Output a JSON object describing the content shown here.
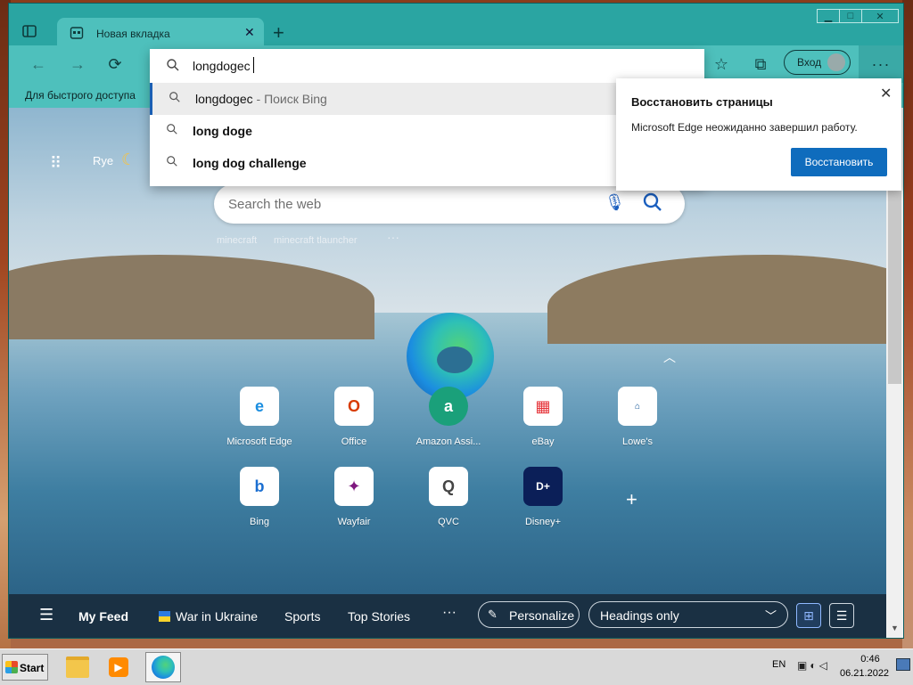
{
  "window": {
    "tab_title": "Новая вкладка",
    "controls": {
      "minimize": "▁",
      "maximize": "□",
      "close": "✕"
    }
  },
  "toolbar": {
    "signin_label": "Вход",
    "menu_label": "···"
  },
  "favorites_bar": {
    "label": "Для быстрого доступа"
  },
  "address_bar": {
    "value": "longdogec",
    "suggestions": [
      {
        "text": "longdogec",
        "suffix": " - Поиск Bing"
      },
      {
        "text": "long doge",
        "suffix": ""
      },
      {
        "text": "long dog challenge",
        "suffix": ""
      }
    ]
  },
  "restore_popup": {
    "title": "Восстановить страницы",
    "message": "Microsoft Edge неожиданно завершил работу.",
    "button": "Восстановить"
  },
  "newtab": {
    "weather_location": "Rye",
    "search_placeholder": "Search the web",
    "recent_searches": [
      "minecraft",
      "minecraft tlauncher"
    ],
    "more": "···",
    "tiles": [
      {
        "label": "Microsoft Edge",
        "icon": "edge-icon",
        "glyph": "e",
        "color": "#1b8ee0"
      },
      {
        "label": "Office",
        "icon": "office-icon",
        "glyph": "O",
        "color": "#d83b01"
      },
      {
        "label": "Amazon Assi...",
        "icon": "amazon-icon",
        "glyph": "a",
        "color": "#1aa07a"
      },
      {
        "label": "eBay",
        "icon": "ebay-icon",
        "glyph": "🛍",
        "color": "#e53238"
      },
      {
        "label": "Lowe's",
        "icon": "lowes-icon",
        "glyph": "L",
        "color": "#004990"
      },
      {
        "label": "Bing",
        "icon": "bing-icon",
        "glyph": "b",
        "color": "#1b6fd1"
      },
      {
        "label": "Wayfair",
        "icon": "wayfair-icon",
        "glyph": "✦",
        "color": "#7f187f"
      },
      {
        "label": "QVC",
        "icon": "qvc-icon",
        "glyph": "Q",
        "color": "#444"
      },
      {
        "label": "Disney+",
        "icon": "disney-icon",
        "glyph": "D+",
        "color": "#0b1f58"
      }
    ]
  },
  "feed_bar": {
    "my_feed": "My Feed",
    "war": "War in Ukraine",
    "sports": "Sports",
    "top_stories": "Top Stories",
    "more": "···",
    "personalize": "Personalize",
    "view_mode": "Headings only"
  },
  "taskbar": {
    "start": "Start",
    "language": "EN",
    "time": "0:46",
    "date": "06.21.2022"
  }
}
